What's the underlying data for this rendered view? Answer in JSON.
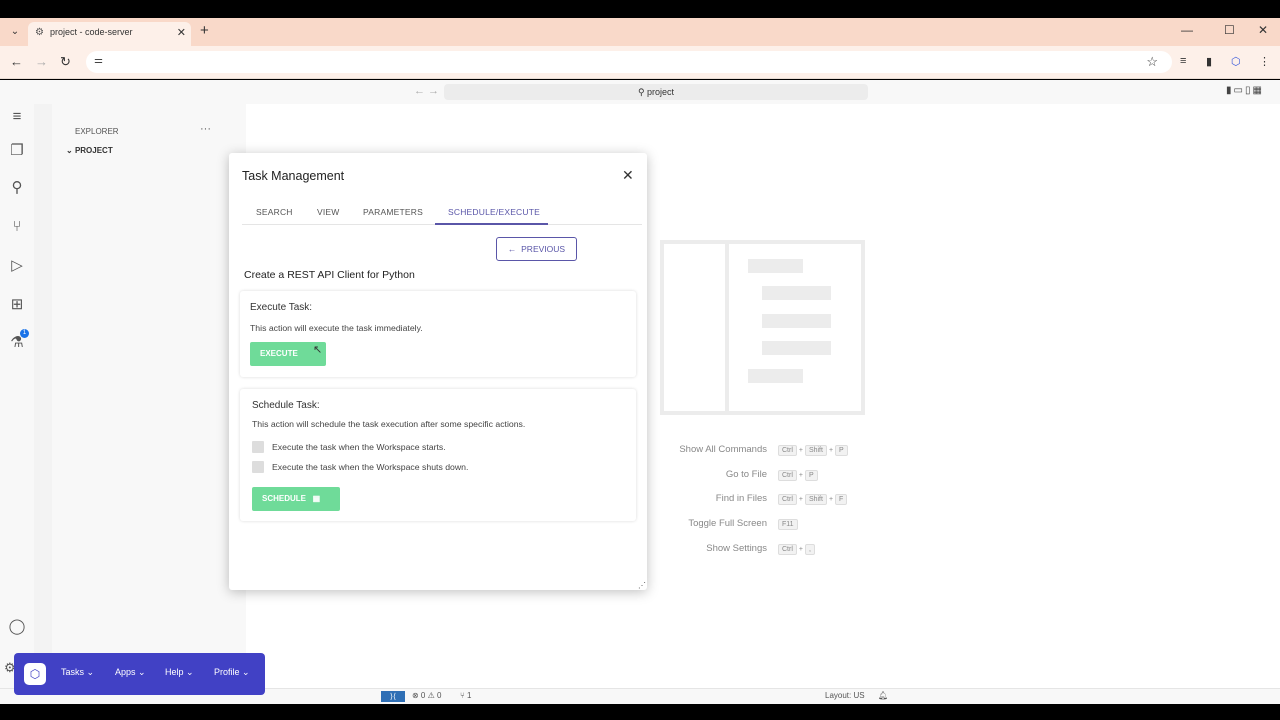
{
  "browser": {
    "tab_title": "project - code-server",
    "tab_favicon": "code-server-icon",
    "new_tab_label": "+",
    "close_label": "✕"
  },
  "editor": {
    "command_center": "project",
    "explorer_title": "EXPLORER",
    "explorer_more": "···",
    "project_label": "PROJECT",
    "extensions_badge": "1"
  },
  "shortcuts": [
    {
      "label": "Show All Commands",
      "keys": [
        "Ctrl",
        "+",
        "Shift",
        "+",
        "P"
      ]
    },
    {
      "label": "Go to File",
      "keys": [
        "Ctrl",
        "+",
        "P"
      ]
    },
    {
      "label": "Find in Files",
      "keys": [
        "Ctrl",
        "+",
        "Shift",
        "+",
        "F"
      ]
    },
    {
      "label": "Toggle Full Screen",
      "keys": [
        "F11"
      ]
    },
    {
      "label": "Show Settings",
      "keys": [
        "Ctrl",
        "+",
        ","
      ]
    }
  ],
  "status": {
    "problems": "⊗ 0 ⚠ 0",
    "ports": "⑂ 1",
    "layout": "Layout: US"
  },
  "modal": {
    "title": "Task Management",
    "tabs": [
      "SEARCH",
      "VIEW",
      "PARAMETERS",
      "SCHEDULE/EXECUTE"
    ],
    "active_tab": "SCHEDULE/EXECUTE",
    "previous_button": "PREVIOUS",
    "task_name": "Create a REST API Client for Python",
    "execute_card": {
      "title": "Execute Task:",
      "description": "This action will execute the task immediately.",
      "button": "EXECUTE"
    },
    "schedule_card": {
      "title": "Schedule Task:",
      "description": "This action will schedule the task execution after some specific actions.",
      "options": [
        "Execute the task when the Workspace starts.",
        "Execute the task when the Workspace shuts down."
      ],
      "button": "SCHEDULE"
    }
  },
  "floatbar": {
    "items": [
      "Tasks",
      "Apps",
      "Help",
      "Profile"
    ]
  },
  "colors": {
    "accent": "#5a56a8",
    "green_button": "#6fdb99",
    "floatbar": "#4141c5",
    "tabbar": "#f9d9c9"
  }
}
